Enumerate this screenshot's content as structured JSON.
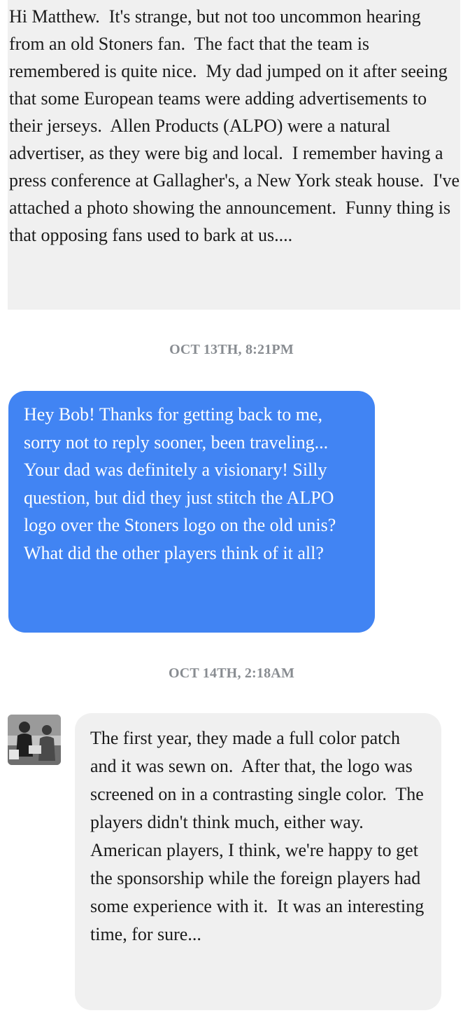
{
  "thread": {
    "quoted_message": {
      "text": "Hi Matthew.  It's strange, but not too uncommon hearing from an old Stoners fan.  The fact that the team is remembered is quite nice.  My dad jumped on it after seeing that some European teams were adding advertisements to their jerseys.  Allen Products (ALPO) were a natural advertiser, as they were big and local.  I remember having a press conference at Gallagher's, a New York steak house.  I've attached a photo showing the announcement.  Funny thing is that opposing fans used to bark at us...."
    },
    "timestamp_1": "OCT 13TH, 8:21PM",
    "outgoing_message": {
      "text": "Hey Bob! Thanks for getting back to me, sorry not to reply sooner, been traveling... Your dad was definitely a visionary! Silly question, but did they just stitch the ALPO logo over the Stoners logo on the old unis? What did the other players think of it all?"
    },
    "timestamp_2": "OCT 14TH, 2:18AM",
    "incoming_message": {
      "text": "The first year, they made a full color patch and it was sewn on.  After that, the logo was screened on in a contrasting single color.  The players didn't think much, either way.  American players, I think, we're happy to get the sponsorship while the foreign players had some experience with it.  It was an interesting time, for sure..."
    }
  },
  "colors": {
    "outgoing_bubble": "#4184f3",
    "incoming_bubble": "#f0f0f0",
    "timestamp": "#888c91"
  },
  "icons": {
    "avatar": "avatar-photo"
  }
}
